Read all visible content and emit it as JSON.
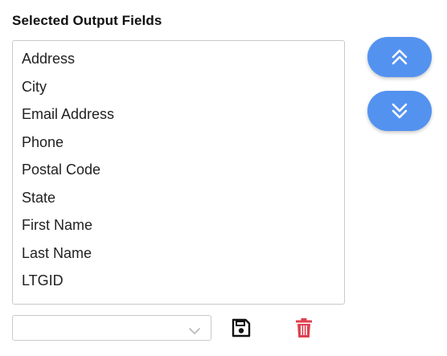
{
  "section": {
    "title": "Selected Output Fields"
  },
  "fields": [
    "Address",
    "City",
    "Email Address",
    "Phone",
    "Postal Code",
    "State",
    "First Name",
    "Last Name",
    "LTGID"
  ],
  "buttons": {
    "move_up_icon": "double-chevron-up-icon",
    "move_down_icon": "double-chevron-down-icon",
    "save_icon": "floppy-disk-icon",
    "delete_icon": "trash-icon"
  },
  "dropdown": {
    "value": ""
  },
  "colors": {
    "accent_button": "#5492f0",
    "delete": "#e0404f",
    "save": "#111111"
  }
}
